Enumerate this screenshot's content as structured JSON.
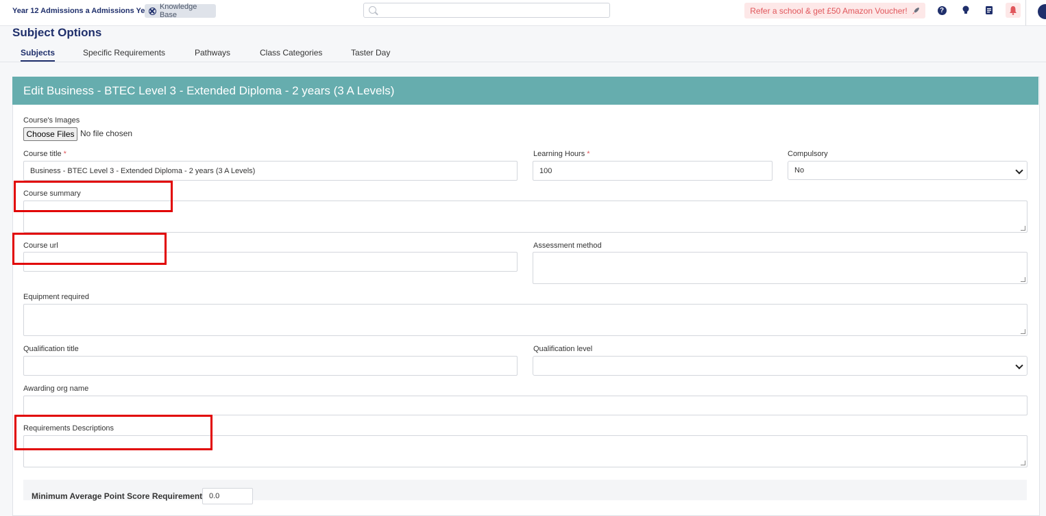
{
  "topbar": {
    "year_selector": "Year 12 Admissions a Admissions Ye...",
    "knowledge_base": "Knowledge Base",
    "search_placeholder": "",
    "refer_banner": "Refer a school & get £50 Amazon Voucher!",
    "help_glyph": "?",
    "icons": [
      "help-icon",
      "lightbulb-icon",
      "document-icon",
      "bell-icon",
      "user-avatar-icon"
    ]
  },
  "page": {
    "title": "Subject Options",
    "tabs": [
      "Subjects",
      "Specific Requirements",
      "Pathways",
      "Class Categories",
      "Taster Day"
    ],
    "active_tab": "Subjects"
  },
  "form": {
    "heading": "Edit Business - BTEC Level 3 - Extended Diploma - 2 years (3 A Levels)",
    "course_images": {
      "label": "Course's Images",
      "button": "Choose Files",
      "status": "No file chosen"
    },
    "course_title": {
      "label": "Course title",
      "required": "*",
      "value": "Business - BTEC Level 3 - Extended Diploma - 2 years (3 A Levels)"
    },
    "learning_hours": {
      "label": "Learning Hours",
      "required": "*",
      "value": "100"
    },
    "compulsory": {
      "label": "Compulsory",
      "value": "No"
    },
    "course_summary": {
      "label": "Course summary",
      "value": ""
    },
    "course_url": {
      "label": "Course url",
      "value": ""
    },
    "assessment_method": {
      "label": "Assessment method",
      "value": ""
    },
    "equipment_required": {
      "label": "Equipment required",
      "value": ""
    },
    "qualification_title": {
      "label": "Qualification title",
      "value": ""
    },
    "qualification_level": {
      "label": "Qualification level",
      "value": ""
    },
    "awarding_org_name": {
      "label": "Awarding org name",
      "value": ""
    },
    "requirements_descriptions": {
      "label": "Requirements Descriptions",
      "value": ""
    },
    "min_score": {
      "label": "Minimum Average Point Score Requirement",
      "value": "0.0"
    }
  },
  "colors": {
    "brand": "#1f2f6b",
    "header_teal": "#66adae",
    "highlight": "#e10000",
    "alert": "#e0565b"
  }
}
